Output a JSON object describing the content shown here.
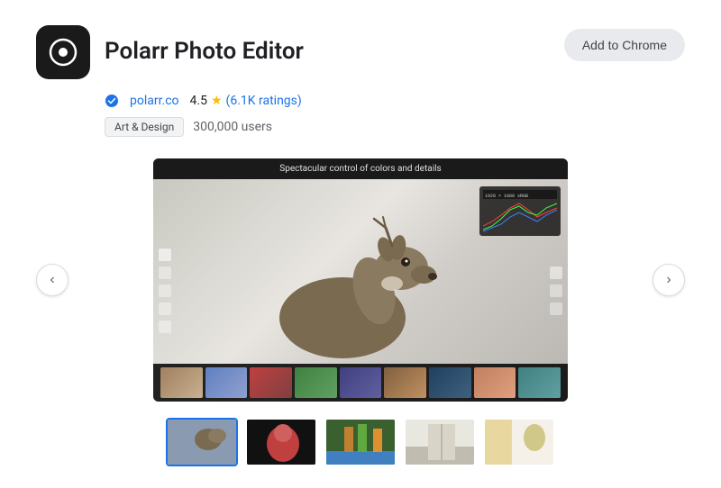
{
  "app": {
    "icon_label": "Polarr app icon",
    "title": "Polarr Photo Editor",
    "publisher": "polarr.co",
    "rating": "4.5",
    "rating_star": "★",
    "rating_count": "(6.1K ratings)",
    "tag": "Art & Design",
    "users": "300,000 users",
    "add_to_chrome_label": "Add to Chrome"
  },
  "screenshot": {
    "title": "Spectacular control of colors and details",
    "nav_left": "‹",
    "nav_right": "›"
  },
  "thumbnails": [
    {
      "id": 1,
      "active": true,
      "label": "Screenshot 1"
    },
    {
      "id": 2,
      "active": false,
      "label": "Screenshot 2"
    },
    {
      "id": 3,
      "active": false,
      "label": "Screenshot 3"
    },
    {
      "id": 4,
      "active": false,
      "label": "Screenshot 4"
    },
    {
      "id": 5,
      "active": false,
      "label": "Screenshot 5"
    }
  ],
  "colors": {
    "accent": "#1a73e8",
    "button_bg": "#e8eaed",
    "tag_bg": "#f1f3f4"
  }
}
